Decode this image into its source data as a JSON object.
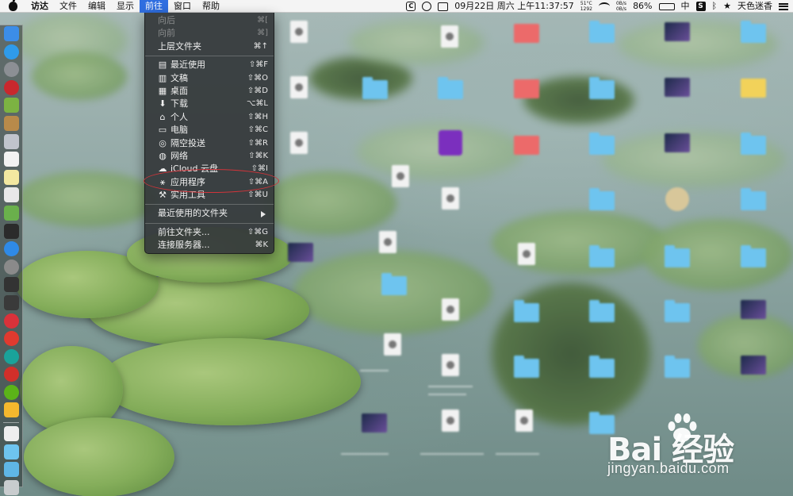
{
  "menubar": {
    "items": [
      "访达",
      "文件",
      "编辑",
      "显示",
      "前往",
      "窗口",
      "帮助"
    ],
    "active_index": 4,
    "status": {
      "clipboard_letter": "C",
      "date_time": "09月22日 周六 上午11:37:57",
      "cpu": "51°C",
      "fan": "1292",
      "net_up": "0B/s",
      "net_down": "0B/s",
      "battery": "86%",
      "input_method": "中",
      "sogou_letter": "S",
      "user": "天色迷香",
      "star": "★"
    }
  },
  "go_menu": {
    "items": [
      {
        "label": "向后",
        "shortcut": "⌘[",
        "icon": "",
        "disabled": true
      },
      {
        "label": "向前",
        "shortcut": "⌘]",
        "icon": "",
        "disabled": true
      },
      {
        "label": "上层文件夹",
        "shortcut": "⌘↑",
        "icon": "",
        "disabled": false
      },
      {
        "separator": true
      },
      {
        "label": "最近使用",
        "shortcut": "⇧⌘F",
        "icon": "recents-icon",
        "disabled": false
      },
      {
        "label": "文稿",
        "shortcut": "⇧⌘O",
        "icon": "documents-icon",
        "disabled": false
      },
      {
        "label": "桌面",
        "shortcut": "⇧⌘D",
        "icon": "desktop-icon",
        "disabled": false
      },
      {
        "label": "下载",
        "shortcut": "⌥⌘L",
        "icon": "downloads-icon",
        "disabled": false
      },
      {
        "label": "个人",
        "shortcut": "⇧⌘H",
        "icon": "home-icon",
        "disabled": false
      },
      {
        "label": "电脑",
        "shortcut": "⇧⌘C",
        "icon": "computer-icon",
        "disabled": false
      },
      {
        "label": "隔空投送",
        "shortcut": "⇧⌘R",
        "icon": "airdrop-icon",
        "disabled": false
      },
      {
        "label": "网络",
        "shortcut": "⇧⌘K",
        "icon": "network-icon",
        "disabled": false
      },
      {
        "label": "iCloud 云盘",
        "shortcut": "⇧⌘I",
        "icon": "icloud-icon",
        "disabled": false
      },
      {
        "label": "应用程序",
        "shortcut": "⇧⌘A",
        "icon": "applications-icon",
        "disabled": false
      },
      {
        "label": "实用工具",
        "shortcut": "⇧⌘U",
        "icon": "utilities-icon",
        "disabled": false
      },
      {
        "separator": true
      },
      {
        "label": "最近使用的文件夹",
        "shortcut": "",
        "icon": "",
        "disabled": false,
        "submenu": true
      },
      {
        "separator": true
      },
      {
        "label": "前往文件夹...",
        "shortcut": "⇧⌘G",
        "icon": "",
        "disabled": false
      },
      {
        "label": "连接服务器...",
        "shortcut": "⌘K",
        "icon": "",
        "disabled": false
      }
    ]
  },
  "dock": {
    "apps": [
      {
        "name": "finder-icon",
        "color": "#3c8de8"
      },
      {
        "name": "safari-icon",
        "color": "#2f9bea"
      },
      {
        "name": "launchpad-icon",
        "color": "#8c8f94"
      },
      {
        "name": "flash-icon",
        "color": "#c9282d"
      },
      {
        "name": "android-icon",
        "color": "#7cb342"
      },
      {
        "name": "box-icon",
        "color": "#b88a4a"
      },
      {
        "name": "preview-icon",
        "color": "#c0c4cc"
      },
      {
        "name": "calendar-icon",
        "color": "#f2f2f2"
      },
      {
        "name": "notes-icon",
        "color": "#f3e8a0"
      },
      {
        "name": "textedit-icon",
        "color": "#e8e8e8"
      },
      {
        "name": "maps-icon",
        "color": "#6ab04c"
      },
      {
        "name": "terminal-icon",
        "color": "#2b2b2b"
      },
      {
        "name": "appstore-icon",
        "color": "#2f8ae6"
      },
      {
        "name": "system-preferences-icon",
        "color": "#8a8a8a"
      },
      {
        "name": "activity-monitor-icon",
        "color": "#333333"
      },
      {
        "name": "console-icon",
        "color": "#3a3a3a"
      },
      {
        "name": "vivaldi-icon",
        "color": "#d9323a"
      },
      {
        "name": "yandex-icon",
        "color": "#e03a2f"
      },
      {
        "name": "teamviewer-icon",
        "color": "#1aa39a"
      },
      {
        "name": "netease-music-icon",
        "color": "#d22f2a"
      },
      {
        "name": "wechat-icon",
        "color": "#5bb318"
      },
      {
        "name": "sketch-icon",
        "color": "#f5b82e"
      }
    ],
    "folders": [
      {
        "name": "document-icon",
        "color": "#eeeeee"
      },
      {
        "name": "folder-icon",
        "color": "#6ec4ef"
      },
      {
        "name": "folder-icon-2",
        "color": "#5fb6e6"
      },
      {
        "name": "trash-icon",
        "color": "#c8ccce"
      }
    ]
  },
  "watermark": {
    "brand": "Bai   经验",
    "url": "jingyan.baidu.com"
  }
}
